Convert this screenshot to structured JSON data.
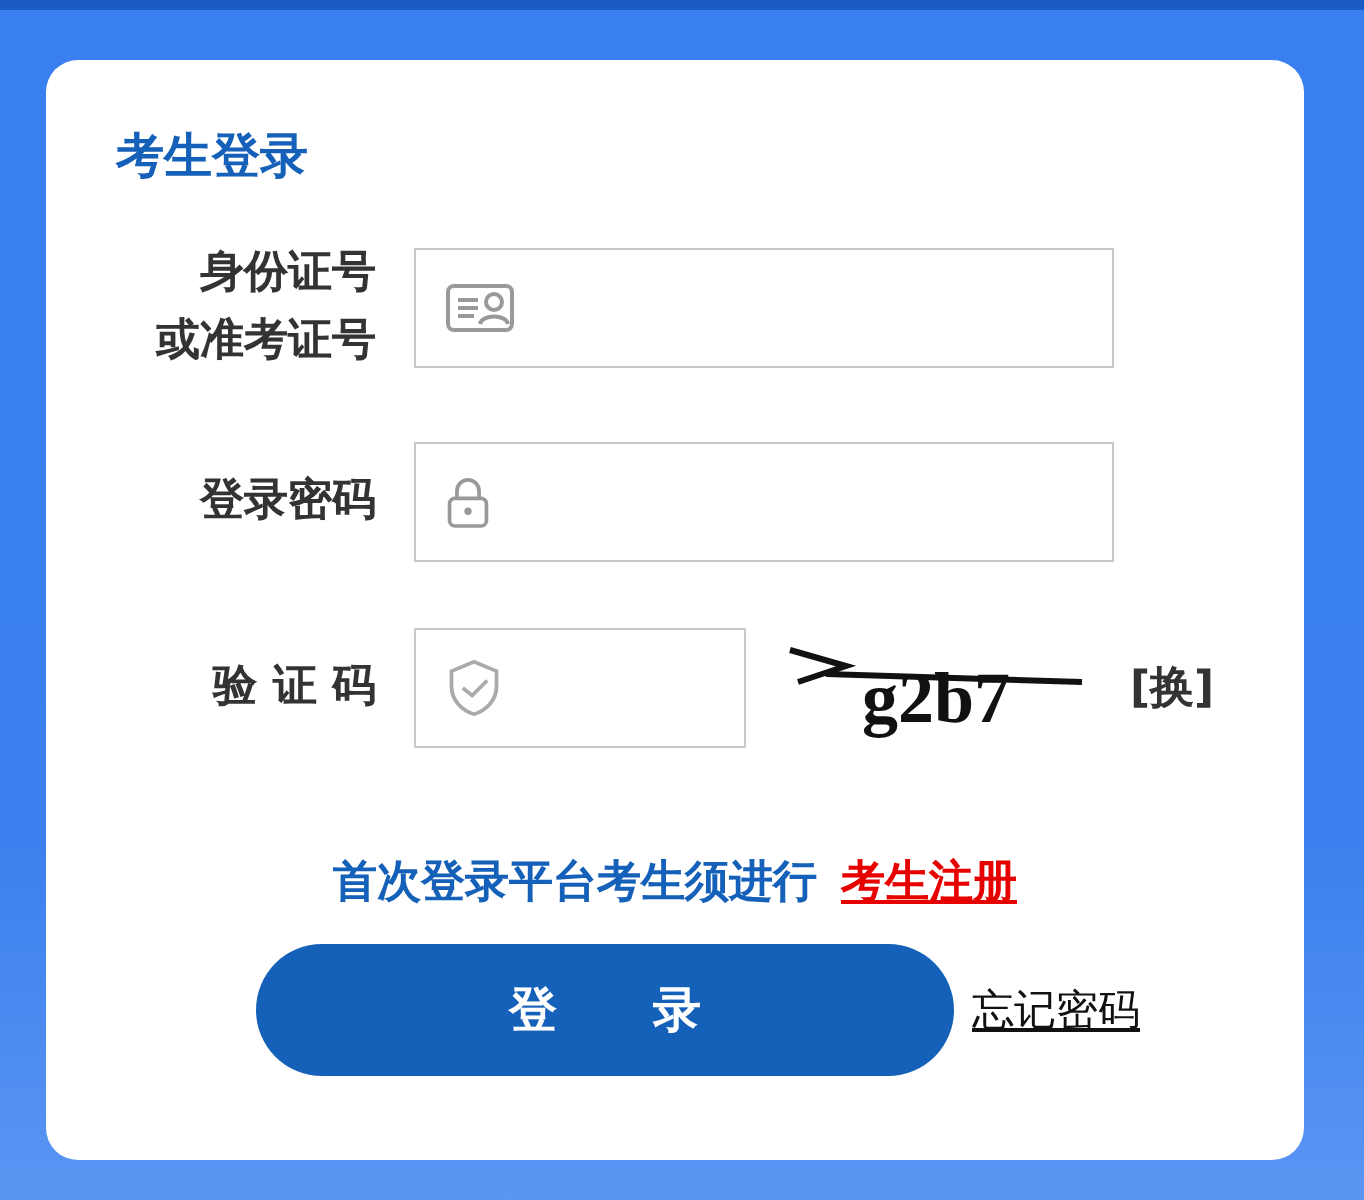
{
  "title": "考生登录",
  "fields": [
    {
      "kind": "account",
      "label_lines": [
        "身份证号",
        "或准考证号"
      ]
    },
    {
      "kind": "password",
      "label_lines": [
        "登录密码"
      ]
    },
    {
      "kind": "captcha",
      "label_lines": [
        "验 证 码"
      ],
      "captcha": "g2b7",
      "refresh": "[换]"
    }
  ],
  "prompt": {
    "text": "首次登录平台考生须进行",
    "link": "考生注册"
  },
  "login_button": "登 录",
  "forgot_link": "忘记密码"
}
